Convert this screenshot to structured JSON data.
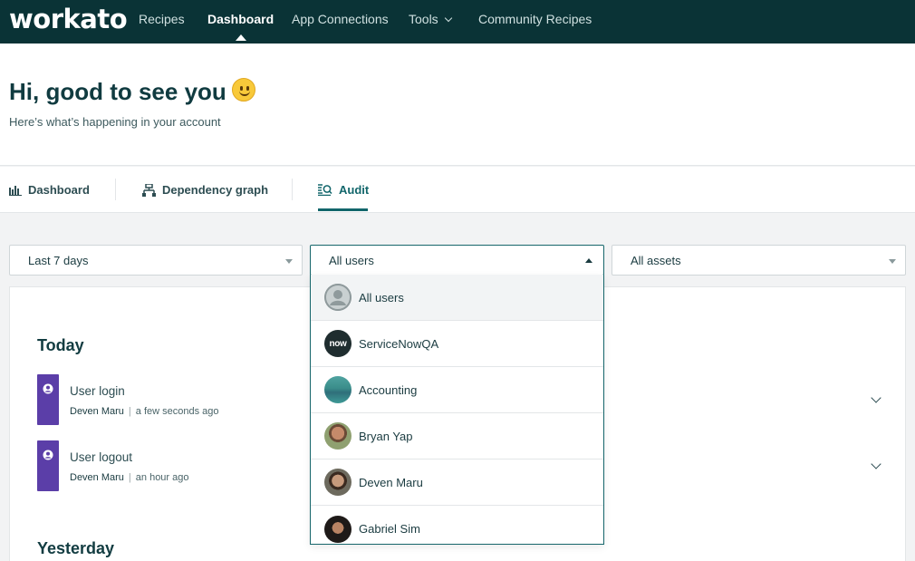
{
  "nav": {
    "logo": "workato",
    "items": [
      {
        "label": "Recipes"
      },
      {
        "label": "Dashboard"
      },
      {
        "label": "App Connections"
      },
      {
        "label": "Tools"
      },
      {
        "label": "Community Recipes"
      }
    ],
    "active": "Dashboard"
  },
  "header": {
    "greeting": "Hi, good to see you",
    "emoji_icon": "smiley-face-icon",
    "subtitle": "Here’s what’s happening in your account"
  },
  "tabs": [
    {
      "label": "Dashboard",
      "icon": "bar-chart-icon"
    },
    {
      "label": "Dependency graph",
      "icon": "hierarchy-icon"
    },
    {
      "label": "Audit",
      "icon": "audit-search-icon"
    }
  ],
  "active_tab": "Audit",
  "filters": {
    "period": "Last 7 days",
    "users": "All users",
    "assets": "All assets"
  },
  "user_options": [
    {
      "label": "All users",
      "avatar": "generic-user-icon"
    },
    {
      "label": "ServiceNowQA",
      "avatar": "now-logo"
    },
    {
      "label": "Accounting",
      "avatar": "landscape-photo"
    },
    {
      "label": "Bryan Yap",
      "avatar": "photo"
    },
    {
      "label": "Deven Maru",
      "avatar": "photo"
    },
    {
      "label": "Gabriel Sim",
      "avatar": "photo"
    }
  ],
  "now_logo_text": "now",
  "audit": {
    "today_label": "Today",
    "yesterday_label": "Yesterday",
    "events": [
      {
        "title": "User login",
        "user": "Deven Maru",
        "time": "a few seconds ago"
      },
      {
        "title": "User logout",
        "user": "Deven Maru",
        "time": "an hour ago"
      }
    ]
  },
  "colors": {
    "nav_bg": "#0a3336",
    "accent": "#12666b",
    "event_bar": "#5b3ea8"
  }
}
